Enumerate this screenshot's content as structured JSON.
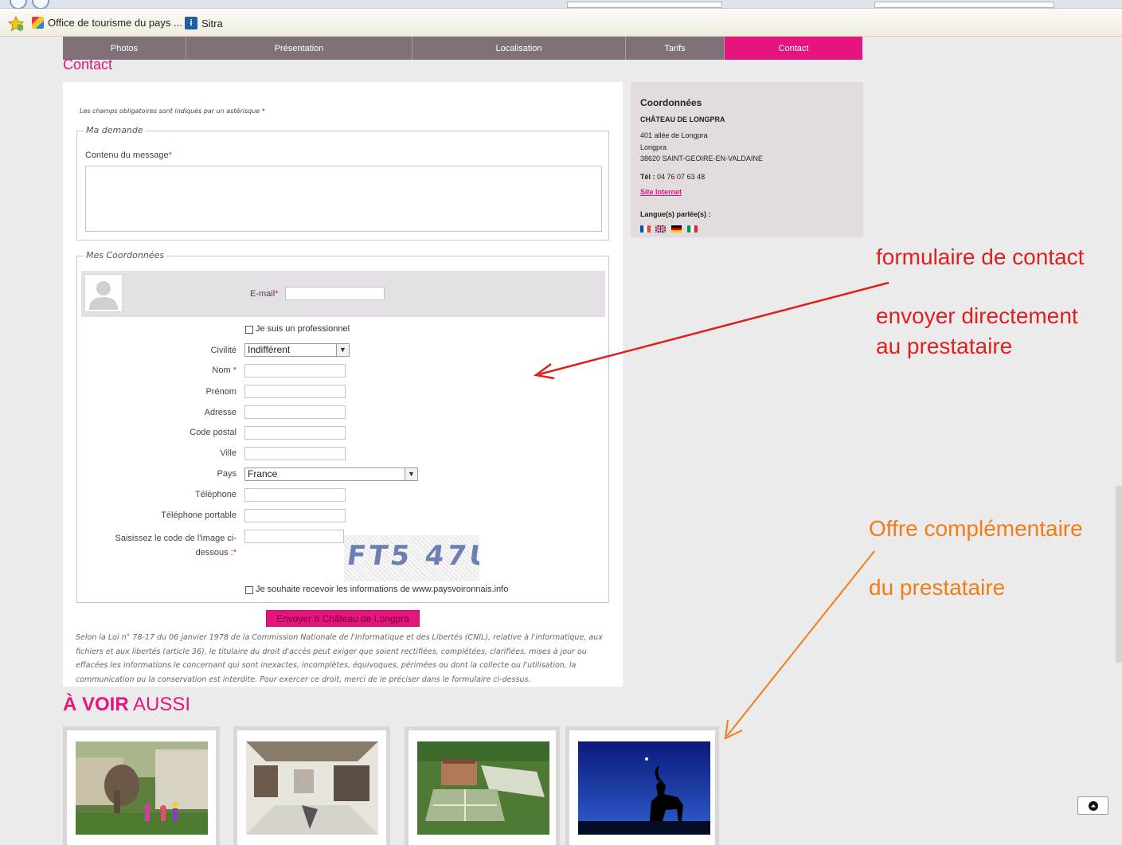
{
  "bookmarks": [
    {
      "label": "Office de tourisme du pays ..."
    },
    {
      "label": "Sitra"
    }
  ],
  "nav": {
    "tabs": [
      {
        "label": "Photos"
      },
      {
        "label": "Présentation"
      },
      {
        "label": "Localisation"
      },
      {
        "label": "Tarifs"
      },
      {
        "label": "Contact",
        "active": true
      }
    ]
  },
  "page": {
    "title": "Contact"
  },
  "form": {
    "required_note": "Les champs obligatoires sont indiqués par un astérisque *",
    "demande": {
      "legend": "Ma demande",
      "message_label": "Contenu du message",
      "message_value": ""
    },
    "coordonnees": {
      "legend": "Mes Coordonnées",
      "email_label": "E-mail",
      "pro_label": "Je suis un professionnel",
      "pro_checked": false,
      "civilite_label": "Civilité",
      "civilite_value": "Indifférent",
      "nom_label": "Nom",
      "prenom_label": "Prénom",
      "adresse_label": "Adresse",
      "code_postal_label": "Code postal",
      "ville_label": "Ville",
      "pays_label": "Pays",
      "pays_value": "France",
      "telephone_label": "Téléphone",
      "telephone_portable_label": "Téléphone portable",
      "captcha_label_1": "Saisissez le code de l'image ci-",
      "captcha_label_2": "dessous :",
      "captcha_text": "FT5 47U",
      "newsletter_label": "Je souhaite recevoir les informations de www.paysvoironnais.info",
      "newsletter_checked": false
    },
    "submit_label": "Envoyer à Château de Longpra",
    "legal_text": "Selon la Loi n° 78-17 du 06 janvier 1978 de la Commission Nationale de l'Informatique et des Libertés (CNIL), relative à l'informatique, aux fichiers et aux libertés (article 36), le titulaire du droit d'accès peut exiger que soient rectifiées, complétées, clarifiées, mises à jour ou effacées les informations le concernant qui sont inexactes, incomplètes, équivoques, périmées ou dont la collecte ou l'utilisation, la communication ou la conservation est interdite. Pour exercer ce droit, merci de le préciser dans le formulaire ci-dessus."
  },
  "side": {
    "title": "Coordonnées",
    "name": "CHÂTEAU DE LONGPRA",
    "address_1": "401 allée de Longpra",
    "address_2": "Longpra",
    "address_3": "38620  SAINT-GEOIRE-EN-VALDAINE",
    "tel_label": "Tél :",
    "tel_value": "04 76 07 63 48",
    "site_link": "Site Internet",
    "languages_label": "Langue(s) parlée(s) :",
    "languages": [
      "fr-flag-icon",
      "uk-flag-icon",
      "de-flag-icon",
      "it-flag-icon"
    ]
  },
  "annotations": {
    "red_1": "formulaire de contact",
    "red_2": "envoyer directement",
    "red_3": "au prestataire",
    "red_color": "#e02020",
    "orange_1": "Offre complémentaire",
    "orange_2": "du prestataire",
    "orange_color": "#f07c1a"
  },
  "see_also": {
    "title_bold": "À VOIR",
    "title_rest": " AUSSI"
  },
  "colors": {
    "accent": "#e6147d",
    "nav": "#7f7079",
    "side_bg": "#e2dcdc"
  }
}
